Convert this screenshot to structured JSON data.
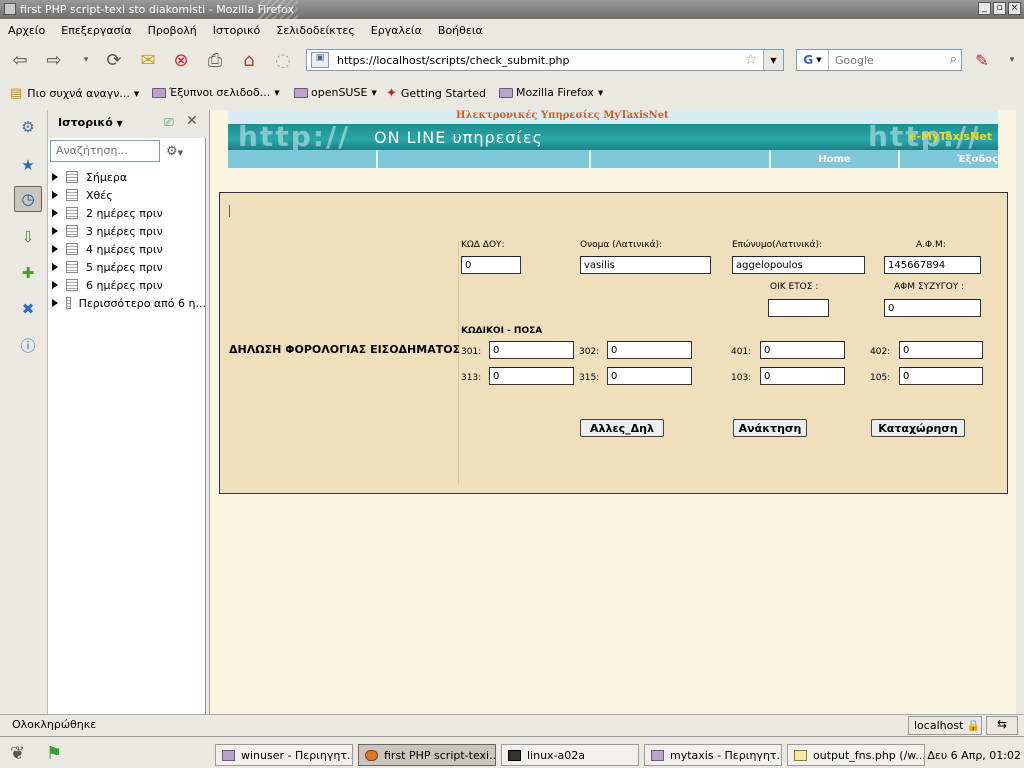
{
  "window": {
    "title": "first PHP script-texi sto diakomisti - Mozilla Firefox",
    "buttons": [
      "_",
      "▫",
      "×"
    ]
  },
  "menu": [
    "Αρχείο",
    "Επεξεργασία",
    "Προβολή",
    "Ιστορικό",
    "Σελιδοδείκτες",
    "Εργαλεία",
    "Βοήθεια"
  ],
  "navbar": {
    "url": "https://localhost/scripts/check_submit.php",
    "search_placeholder": "Google",
    "search_engine": "G",
    "icons": [
      "back-icon",
      "forward-icon",
      "history-dropdown-icon",
      "reload-icon",
      "new-bookmark-icon",
      "stop-icon",
      "print-icon",
      "home-icon",
      "throbber-icon",
      "site-identity-icon",
      "star-icon",
      "url-dropdown-icon",
      "search-engine-icon",
      "magnifier-icon",
      "notes-icon"
    ]
  },
  "bookmarks": [
    {
      "label": "Πιο συχνά αναγν...",
      "dropdown": true
    },
    {
      "label": "Έξυπνοι σελιδοδ...",
      "dropdown": true
    },
    {
      "label": "openSUSE",
      "dropdown": true
    },
    {
      "label": "Getting Started",
      "dropdown": false
    },
    {
      "label": "Mozilla Firefox",
      "dropdown": true
    }
  ],
  "sidebar": {
    "title": "Ιστορικό",
    "search_placeholder": "Αναζήτηση...",
    "items": [
      "Σήμερα",
      "Χθές",
      "2 ημέρες πριν",
      "3 ημέρες πριν",
      "4 ημέρες πριν",
      "5 ημέρες πριν",
      "6 ημέρες πριν",
      "Περισσότερο από 6 η..."
    ]
  },
  "page": {
    "header_title": "Ηλεκτρονικές Υπηρεσίες MyTaxisNet",
    "banner_text": "ON LINE υπηρεσίες",
    "banner_ghost_left": "http://",
    "banner_ghost_right": "http://",
    "banner_brand": "e-MyTaxisNet",
    "nav_home": "Home",
    "nav_exit": "Έξοδος",
    "form": {
      "title": "ΔΗΛΩΣΗ ΦΟΡΟΛΟΓΙΑΣ ΕΙΣΟΔΗΜΑΤΟΣ",
      "kod_doy_label": "ΚΩΔ ΔΟΥ:",
      "kod_doy_value": "0",
      "onoma_label": "Ονομα (Λατινικά):",
      "onoma_value": "vasilis",
      "eponymo_label": "Επώνυμο(Λατινικά):",
      "eponymo_value": "aggelopoulos",
      "afm_label": "Α.Φ.Μ:",
      "afm_value": "145667894",
      "oik_etos_label": "ΟΙΚ ΕΤΟΣ :",
      "oik_etos_value": "",
      "afm_syzygou_label": "ΑΦΜ ΣΥΖΥΓΟΥ :",
      "afm_syzygou_value": "0",
      "codes_heading": "ΚΩΔΙΚΟΙ - ΠΟΣΑ",
      "codes": [
        {
          "code": "301:",
          "value": "0"
        },
        {
          "code": "302:",
          "value": "0"
        },
        {
          "code": "401:",
          "value": "0"
        },
        {
          "code": "402:",
          "value": "0"
        },
        {
          "code": "313:",
          "value": "0"
        },
        {
          "code": "315:",
          "value": "0"
        },
        {
          "code": "103:",
          "value": "0"
        },
        {
          "code": "105:",
          "value": "0"
        }
      ],
      "btn_other": "Αλλες_Δηλ",
      "btn_retrieve": "Ανάκτηση",
      "btn_submit": "Καταχώρηση"
    }
  },
  "status": {
    "text": "Ολοκληρώθηκε",
    "host": "localhost"
  },
  "taskbar": {
    "tasks": [
      {
        "label": "winuser - Περιηγητ...",
        "active": false
      },
      {
        "label": "first PHP script-texi...",
        "active": true
      },
      {
        "label": "linux-a02a",
        "active": false
      },
      {
        "label": "mytaxis - Περιηγητ...",
        "active": false
      },
      {
        "label": "output_fns.php (/w...",
        "active": false
      }
    ],
    "clock": "Δευ  6 Απρ, 01:02"
  }
}
